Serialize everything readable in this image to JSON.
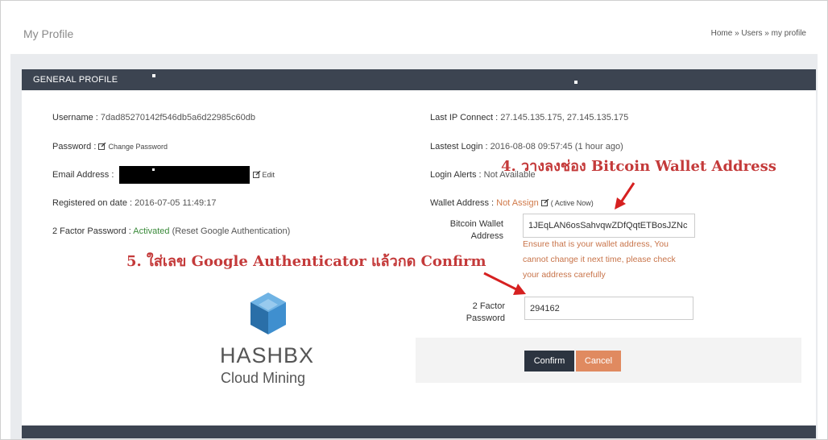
{
  "page": {
    "title": "My Profile",
    "breadcrumb": "Home » Users » my profile"
  },
  "panel": {
    "title": "GENERAL PROFILE"
  },
  "left": {
    "username_label": "Username : ",
    "username_value": "7dad85270142f546db5a6d22985c60db",
    "password_label": "Password : ",
    "change_password": "Change Password",
    "email_label": "Email Address : ",
    "edit": "Edit",
    "registered_label": "Registered on date : ",
    "registered_value": "2016-07-05 11:49:17",
    "twofactor_label": "2 Factor Password : ",
    "twofactor_status": "Activated",
    "twofactor_reset": " (Reset Google Authentication)"
  },
  "right": {
    "last_ip_label": "Last IP Connect : ",
    "last_ip_value": "27.145.135.175, 27.145.135.175",
    "last_login_label": "Lastest Login : ",
    "last_login_value": "2016-08-08 09:57:45 (1 hour ago)",
    "login_alerts_label": "Login Alerts : ",
    "login_alerts_value": "Not Available",
    "wallet_label": "Wallet Address : ",
    "wallet_status": "Not Assign",
    "wallet_active": "( Active Now)"
  },
  "form": {
    "bitcoin_label_1": "Bitcoin Wallet",
    "bitcoin_label_2": "Address",
    "bitcoin_value": "1JEqLAN6osSahvqwZDfQqtETBosJZNc",
    "warning_1": "Ensure that is your wallet address, You",
    "warning_2": "cannot change it next time, please check",
    "warning_3": "your address carefully",
    "twofactor_label_1": "2 Factor",
    "twofactor_label_2": "Password",
    "twofactor_value": "294162",
    "confirm": "Confirm",
    "cancel": "Cancel"
  },
  "annotations": {
    "step4": "4. วางลงช่อง Bitcoin Wallet Address",
    "step5": "5. ใส่เลข Google Authenticator แล้วกด Confirm"
  },
  "logo": {
    "name": "HASHBX",
    "sub": "Cloud Mining"
  },
  "colors": {
    "header": "#3c4451",
    "annotation": "#c43a3a",
    "confirm": "#2c3440",
    "cancel": "#e08a60",
    "activated": "#3a8a3a",
    "warning": "#c8744a"
  }
}
